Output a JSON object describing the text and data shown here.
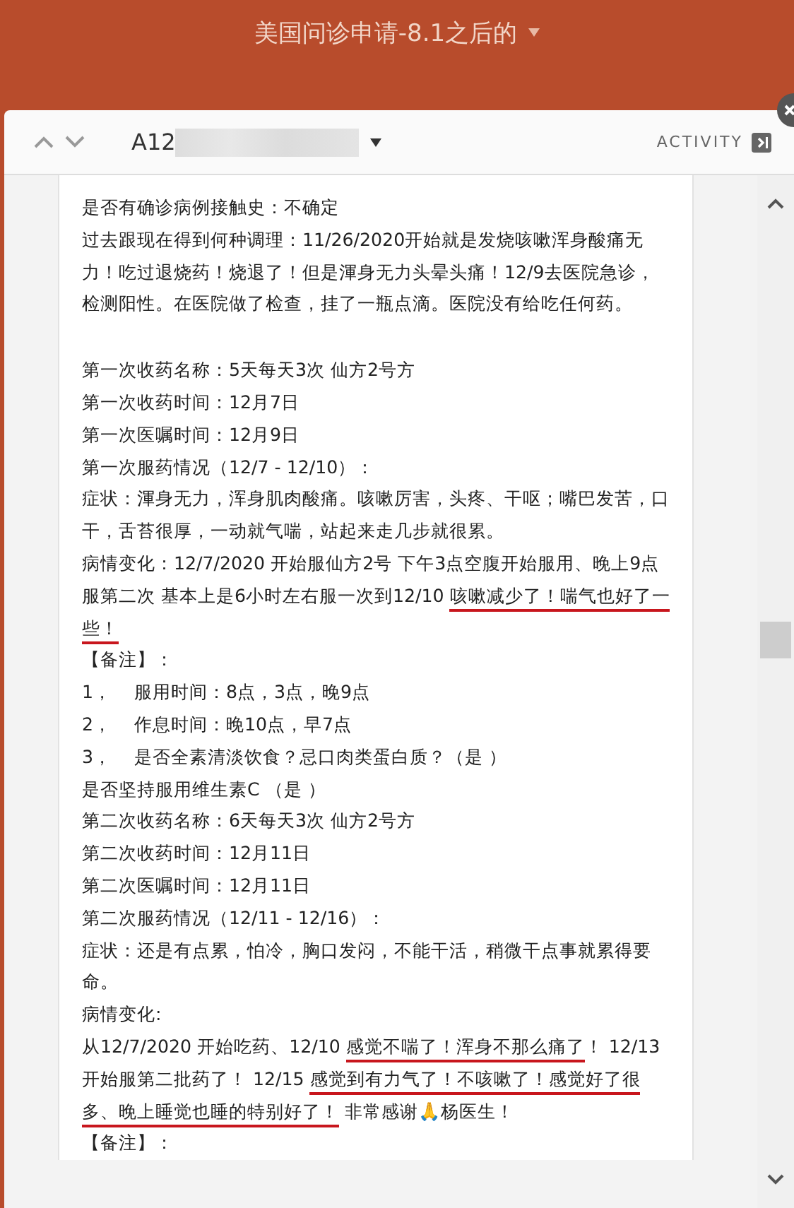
{
  "header": {
    "title": "美国问诊申请-8.1之后的"
  },
  "record": {
    "id": "A12",
    "activity": "ACTIVITY"
  },
  "sections": [
    {
      "paragraphs": [
        {
          "segments": [
            {
              "text": "是否有确诊病例接触史：不确定",
              "underlined": false
            }
          ]
        },
        {
          "segments": [
            {
              "text": "过去跟现在得到何种调理：11/26/2020开始就是发烧咳嗽浑身酸痛无力！吃过退烧药！烧退了！但是渾身无力头晕头痛！12/9去医院急诊，检测阳性。在医院做了检查，挂了一瓶点滴。医院没有给吃任何药。",
              "underlined": false
            }
          ]
        }
      ]
    },
    {
      "paragraphs": [
        {
          "segments": [
            {
              "text": "第一次收药名称：5天每天3次 仙方2号方",
              "underlined": false
            }
          ]
        },
        {
          "segments": [
            {
              "text": "第一次收药时间：12月7日",
              "underlined": false
            }
          ]
        },
        {
          "segments": [
            {
              "text": "第一次医嘱时间：12月9日",
              "underlined": false
            }
          ]
        },
        {
          "segments": [
            {
              "text": "第一次服药情况（12/7 - 12/10）：",
              "underlined": false
            }
          ]
        },
        {
          "segments": [
            {
              "text": "症状：渾身无力，浑身肌肉酸痛。咳嗽厉害，头疼、干呕；嘴巴发苦，口干，舌苔很厚，一动就气喘，站起来走几步就很累。",
              "underlined": false
            }
          ]
        },
        {
          "segments": [
            {
              "text": "病情变化：12/7/2020 开始服仙方2号 下午3点空腹开始服用、晚上9点服第二次 基本上是6小时左右服一次到12/10 ",
              "underlined": false
            },
            {
              "text": "咳嗽减少了！喘气也好了一些！",
              "underlined": true
            }
          ]
        },
        {
          "segments": [
            {
              "text": "【备注】：",
              "underlined": false
            }
          ]
        },
        {
          "segments": [
            {
              "text": "1，    服用时间：8点，3点，晚9点",
              "underlined": false
            }
          ]
        },
        {
          "segments": [
            {
              "text": "2，    作息时间：晚10点，早7点",
              "underlined": false
            }
          ]
        },
        {
          "segments": [
            {
              "text": "3，    是否全素清淡饮食？忌口肉类蛋白质？（是 ）",
              "underlined": false
            }
          ]
        },
        {
          "segments": [
            {
              "text": "是否坚持服用维生素C （是 ）",
              "underlined": false
            }
          ]
        },
        {
          "segments": [
            {
              "text": "第二次收药名称：6天每天3次 仙方2号方",
              "underlined": false
            }
          ]
        },
        {
          "segments": [
            {
              "text": "第二次收药时间：12月11日",
              "underlined": false
            }
          ]
        },
        {
          "segments": [
            {
              "text": "第二次医嘱时间：12月11日",
              "underlined": false
            }
          ]
        },
        {
          "segments": [
            {
              "text": "第二次服药情况（12/11 - 12/16）：",
              "underlined": false
            }
          ]
        },
        {
          "segments": [
            {
              "text": "症状：还是有点累，怕冷，胸口发闷，不能干活，稍微干点事就累得要命。",
              "underlined": false
            }
          ]
        },
        {
          "segments": [
            {
              "text": "病情变化:",
              "underlined": false
            }
          ]
        },
        {
          "segments": [
            {
              "text": "从12/7/2020 开始吃药、12/10 ",
              "underlined": false
            },
            {
              "text": "感觉不喘了！浑身不那么痛了",
              "underlined": true
            },
            {
              "text": "！ 12/13开始服第二批药了！ 12/15 ",
              "underlined": false
            },
            {
              "text": "感觉到有力气了！不咳嗽了！感觉好了很多、晚上睡觉也睡的特别好了！",
              "underlined": true
            },
            {
              "text": " 非常感谢🙏杨医生！",
              "underlined": false
            }
          ]
        },
        {
          "segments": [
            {
              "text": "【备注】：",
              "underlined": false
            }
          ]
        }
      ]
    }
  ]
}
